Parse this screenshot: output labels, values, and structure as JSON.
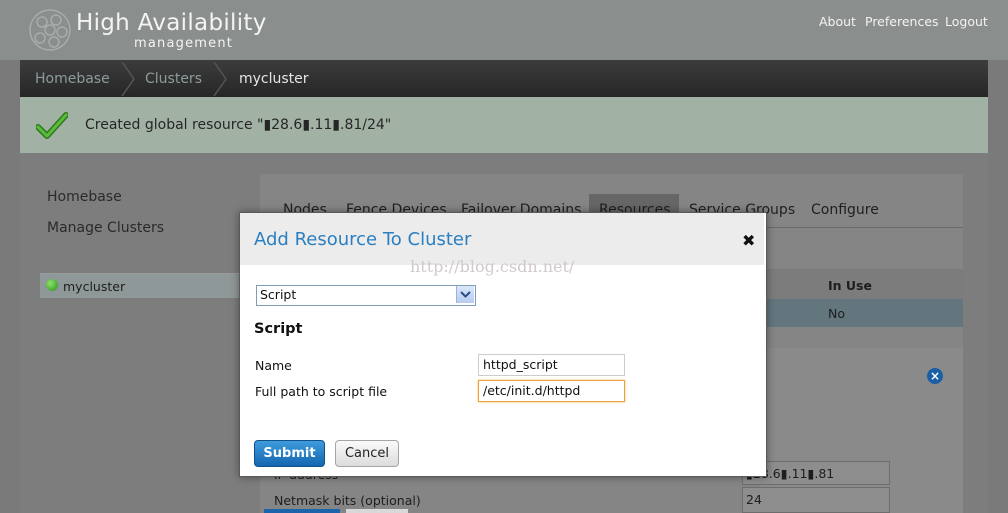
{
  "header": {
    "brand_title": "High Availability",
    "brand_subtitle": "management",
    "links": [
      "About",
      "Preferences",
      "Logout"
    ]
  },
  "breadcrumb": [
    "Homebase",
    "Clusters",
    "mycluster"
  ],
  "notice": {
    "text": "Created global resource \"▮28.6▮.11▮.81/24\""
  },
  "left_nav": {
    "items": [
      "Homebase",
      "Manage Clusters"
    ],
    "cluster": {
      "name": "mycluster",
      "status_color": "#3da91f"
    }
  },
  "tabs": [
    "Nodes",
    "Fence Devices",
    "Failover Domains",
    "Resources",
    "Service Groups",
    "Configure"
  ],
  "resource_table": {
    "in_use_header": "In Use",
    "rows": [
      {
        "in_use": "No"
      }
    ]
  },
  "background_form": {
    "ip_label": "IP address",
    "ip_value": "▮28.6▮.11▮.81",
    "netmask_label": "Netmask bits (optional)",
    "netmask_value": "24"
  },
  "dialog": {
    "title": "Add Resource To Cluster",
    "watermark": "http://blog.csdn.net/",
    "resource_type": "Script",
    "section_title": "Script",
    "fields": [
      {
        "label": "Name",
        "value": "httpd_script"
      },
      {
        "label": "Full path to script file",
        "value": "/etc/init.d/httpd"
      }
    ],
    "submit_label": "Submit",
    "cancel_label": "Cancel"
  },
  "colors": {
    "accent": "#2b7fc0",
    "notice_bg": "#a1b2a5",
    "submit_bg": "#1466b0"
  }
}
